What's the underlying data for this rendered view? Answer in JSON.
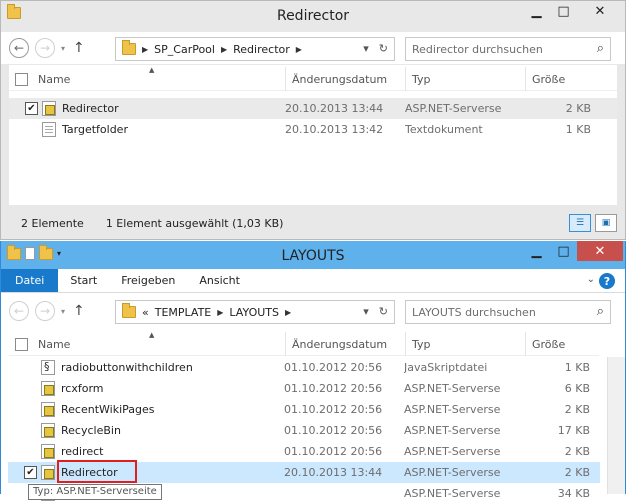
{
  "window1": {
    "title": "Redirector",
    "address": {
      "segments": [
        "SP_CarPool",
        "Redirector"
      ]
    },
    "search_placeholder": "Redirector durchsuchen",
    "columns": [
      "Name",
      "Änderungsdatum",
      "Typ",
      "Größe"
    ],
    "rows": [
      {
        "name": "Redirector",
        "date": "20.10.2013 13:44",
        "type": "ASP.NET-Serverseite",
        "size": "2 KB",
        "icon": "aspx-file-icon",
        "checked": true
      },
      {
        "name": "Targetfolder",
        "date": "20.10.2013 13:42",
        "type": "Textdokument",
        "size": "1 KB",
        "icon": "text-file-icon",
        "checked": false
      }
    ],
    "status": {
      "count": "2 Elemente",
      "selection": "1 Element ausgewählt (1,03 KB)"
    }
  },
  "window2": {
    "title": "LAYOUTS",
    "ribbon": [
      "Datei",
      "Start",
      "Freigeben",
      "Ansicht"
    ],
    "address": {
      "prefix": "«",
      "segments": [
        "TEMPLATE",
        "LAYOUTS"
      ]
    },
    "search_placeholder": "LAYOUTS durchsuchen",
    "columns": [
      "Name",
      "Änderungsdatum",
      "Typ",
      "Größe"
    ],
    "rows": [
      {
        "name": "radiobuttonwithchildren",
        "date": "01.10.2012 20:56",
        "type": "JavaSkriptdatei",
        "size": "1 KB",
        "icon": "js-file-icon"
      },
      {
        "name": "rcxform",
        "date": "01.10.2012 20:56",
        "type": "ASP.NET-Serverseite",
        "size": "6 KB",
        "icon": "aspx-file-icon"
      },
      {
        "name": "RecentWikiPages",
        "date": "01.10.2012 20:56",
        "type": "ASP.NET-Serverseite",
        "size": "2 KB",
        "icon": "aspx-file-icon"
      },
      {
        "name": "RecycleBin",
        "date": "01.10.2012 20:56",
        "type": "ASP.NET-Serverseite",
        "size": "17 KB",
        "icon": "aspx-file-icon"
      },
      {
        "name": "redirect",
        "date": "01.10.2012 20:56",
        "type": "ASP.NET-Serverseite",
        "size": "2 KB",
        "icon": "aspx-file-icon"
      },
      {
        "name": "Redirector",
        "date": "20.10.2013 13:44",
        "type": "ASP.NET-Serverseite",
        "size": "2 KB",
        "icon": "aspx-file-icon",
        "checked": true
      },
      {
        "name": "",
        "date": "",
        "type": "ASP.NET-Serverseite",
        "size": "34 KB",
        "icon": "aspx-file-icon"
      }
    ],
    "tooltip": "Typ: ASP.NET-Serverseite"
  },
  "colors": {
    "accent": "#1979ca",
    "selection": "#cce8ff",
    "close_red": "#c7504c",
    "highlight_box": "#e02020"
  }
}
